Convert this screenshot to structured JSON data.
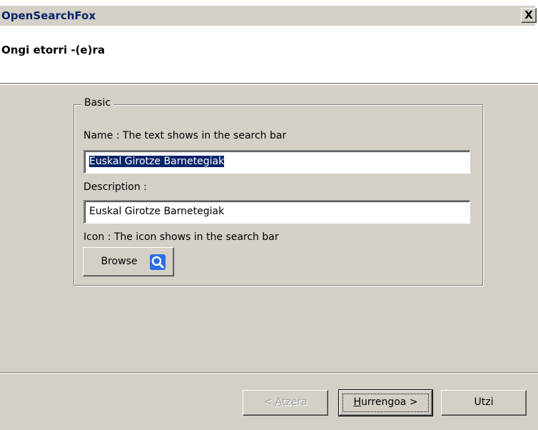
{
  "window": {
    "title": "OpenSearchFox",
    "close_label": "X"
  },
  "header": {
    "title": "Ongi etorri -(e)ra"
  },
  "group": {
    "legend": "Basic",
    "name_label": "Name : The text shows in the search bar",
    "name_value": "Euskal Girotze Barnetegiak",
    "description_label": "Description :",
    "description_value": "Euskal Girotze Barnetegiak",
    "icon_label": "Icon : The icon shows in the search bar",
    "browse_label": "Browse",
    "browse_icon": "magnifier-icon"
  },
  "footer": {
    "back_prefix": "< ",
    "back_mnemonic": "A",
    "back_rest": "tzera",
    "next_mnemonic": "H",
    "next_rest": "urrengoa >",
    "cancel_label": "Utzi"
  },
  "colors": {
    "selection": "#0a246a",
    "dialog_bg": "#d4d0c8",
    "icon_blue": "#2a6ee8"
  }
}
